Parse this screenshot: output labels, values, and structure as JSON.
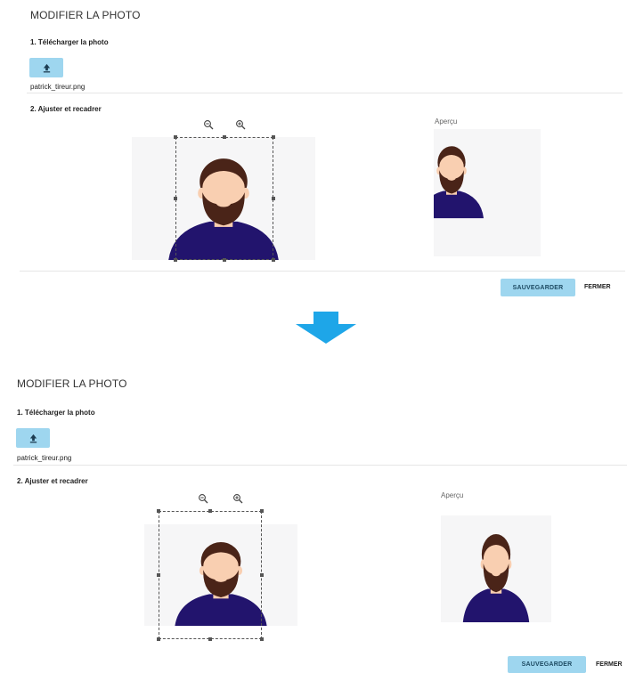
{
  "top": {
    "title": "MODIFIER LA PHOTO",
    "step1_label": "1. Télécharger la photo",
    "filename": "patrick_tireur.png",
    "step2_label": "2. Ajuster et recadrer",
    "preview_label": "Aperçu",
    "save_label": "SAUVEGARDER",
    "close_label": "FERMER"
  },
  "bottom": {
    "title": "MODIFIER LA PHOTO",
    "step1_label": "1. Télécharger la photo",
    "filename": "patrick_tireur.png",
    "step2_label": "2. Ajuster et recadrer",
    "preview_label": "Aperçu",
    "save_label": "SAUVEGARDER",
    "close_label": "FERMER"
  },
  "icons": {
    "upload": "upload-icon",
    "zoom_out": "zoom-out-icon",
    "zoom_in": "zoom-in-icon",
    "arrow": "arrow-down-icon"
  },
  "colors": {
    "accent_button": "#9ed6ef",
    "arrow": "#1ea6e8",
    "hair": "#4a2418",
    "skin": "#f9cfb1",
    "shirt": "#22146d",
    "photo_bg": "#f6f6f7"
  }
}
